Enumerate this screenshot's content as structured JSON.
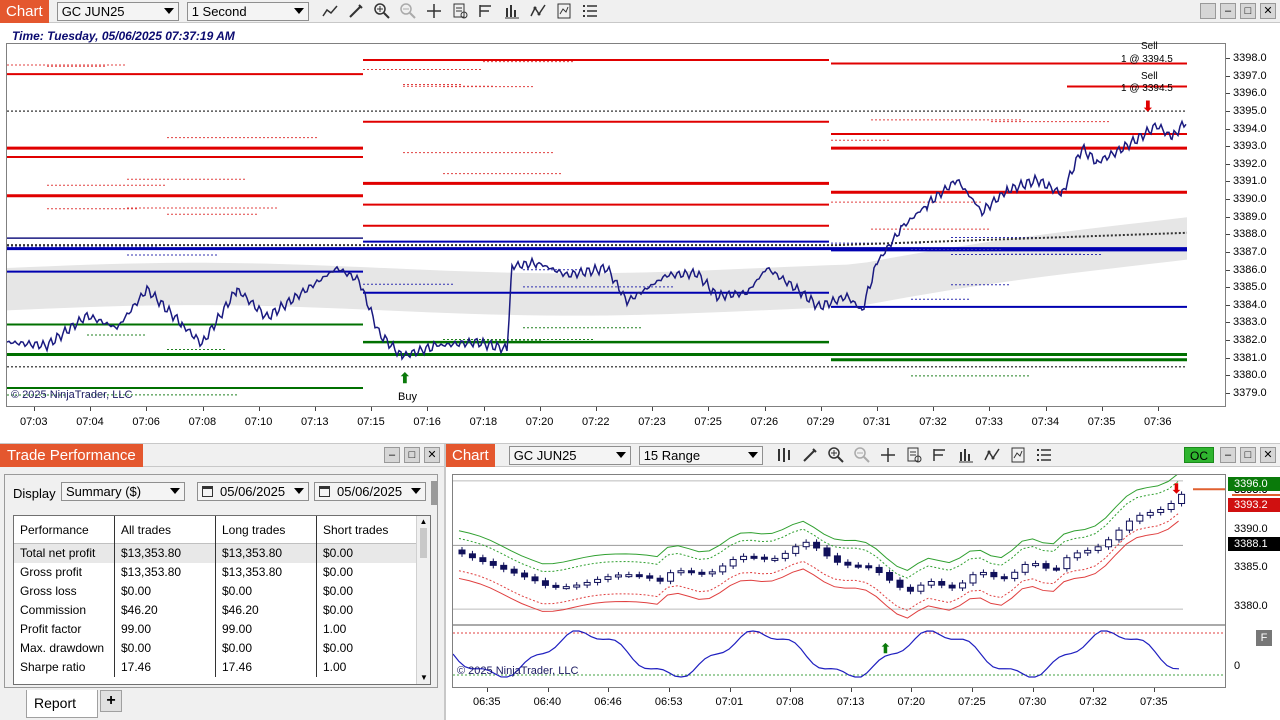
{
  "top_chart": {
    "tab_label": "Chart",
    "instrument": "GC JUN25",
    "interval": "1 Second",
    "time_label": "Time: Tuesday, 05/06/2025 07:37:19 AM",
    "copyright": "© 2025 NinjaTrader, LLC",
    "buy_label": "Buy",
    "sell_label_1": "Sell",
    "sell_qty_1": "1 @ 3394.5",
    "sell_label_2": "Sell",
    "sell_qty_2": "1 @ 3394.5",
    "y_ticks": [
      "3398.0",
      "3397.0",
      "3396.0",
      "3395.0",
      "3394.0",
      "3393.0",
      "3392.0",
      "3391.0",
      "3390.0",
      "3389.0",
      "3388.0",
      "3387.0",
      "3386.0",
      "3385.0",
      "3384.0",
      "3383.0",
      "3382.0",
      "3381.0",
      "3380.0",
      "3379.0"
    ],
    "x_ticks": [
      "07:03",
      "07:04",
      "07:06",
      "07:08",
      "07:10",
      "07:13",
      "07:15",
      "07:16",
      "07:18",
      "07:20",
      "07:22",
      "07:23",
      "07:25",
      "07:26",
      "07:29",
      "07:31",
      "07:32",
      "07:33",
      "07:34",
      "07:35",
      "07:36"
    ]
  },
  "trade_performance": {
    "title": "Trade Performance",
    "display_label": "Display",
    "display_value": "Summary ($)",
    "date_from": "05/06/2025",
    "date_to": "05/06/2025",
    "columns": [
      "Performance",
      "All trades",
      "Long trades",
      "Short trades"
    ],
    "rows": [
      [
        "Total net profit",
        "$13,353.80",
        "$13,353.80",
        "$0.00"
      ],
      [
        "Gross profit",
        "$13,353.80",
        "$13,353.80",
        "$0.00"
      ],
      [
        "Gross loss",
        "$0.00",
        "$0.00",
        "$0.00"
      ],
      [
        "Commission",
        "$46.20",
        "$46.20",
        "$0.00"
      ],
      [
        "Profit factor",
        "99.00",
        "99.00",
        "1.00"
      ],
      [
        "Max. drawdown",
        "$0.00",
        "$0.00",
        "$0.00"
      ],
      [
        "Sharpe ratio",
        "17.46",
        "17.46",
        "1.00"
      ]
    ],
    "tab_report": "Report",
    "tab_add": "+"
  },
  "bottom_chart": {
    "tab_label": "Chart",
    "instrument": "GC JUN25",
    "interval": "15 Range",
    "oc_label": "OC",
    "copyright": "© 2025 NinjaTrader, LLC",
    "price_tags": [
      "3396.0",
      "3393.2",
      "3388.1"
    ],
    "price_tag_partial": "3395.0",
    "y_ticks": [
      "3395.0",
      "3390.0",
      "3385.0",
      "3380.0"
    ],
    "osc_tick": "0",
    "f_label": "F",
    "x_ticks": [
      "06:35",
      "06:40",
      "06:46",
      "06:53",
      "07:01",
      "07:08",
      "07:13",
      "07:20",
      "07:25",
      "07:30",
      "07:32",
      "07:35"
    ]
  },
  "colors": {
    "accent": "#e4572e",
    "price_line": "#1a1a80",
    "resistance": "#e00000",
    "support": "#007000",
    "oc_green": "#2fb52f",
    "tag_green": "#0a7a0a",
    "tag_red": "#d01010"
  }
}
